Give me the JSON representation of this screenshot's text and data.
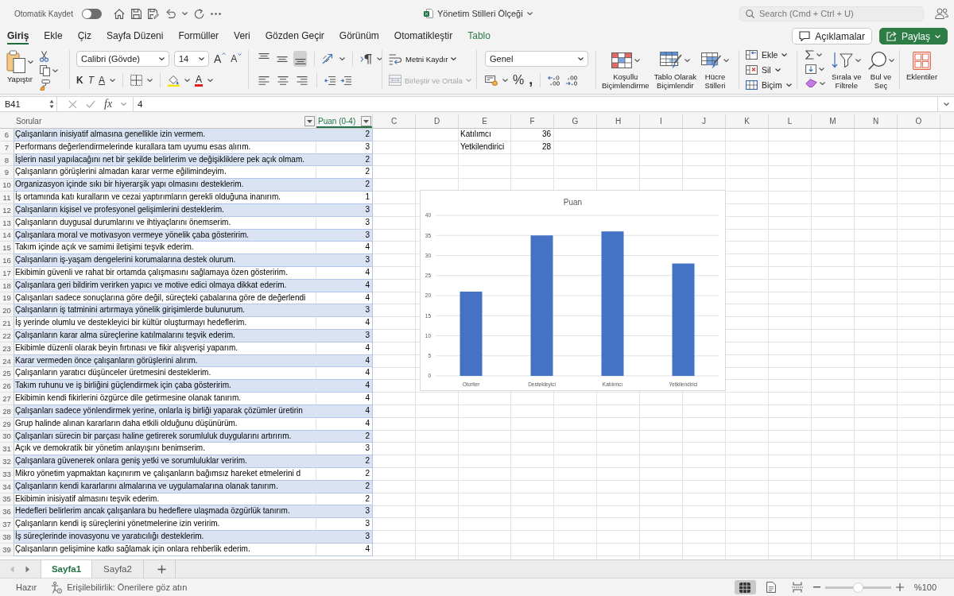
{
  "title_bar": {
    "autosave": {
      "label": "Otomatik Kaydet",
      "on": false
    },
    "document_title": "Yönetim Stilleri Ölçeği",
    "search": {
      "placeholder": "Search (Cmd + Ctrl + U)"
    }
  },
  "ribbon_tabs": [
    {
      "label": "Giriş",
      "selected": true,
      "kind": "standard"
    },
    {
      "label": "Ekle",
      "selected": false,
      "kind": "standard"
    },
    {
      "label": "Çiz",
      "selected": false,
      "kind": "standard"
    },
    {
      "label": "Sayfa Düzeni",
      "selected": false,
      "kind": "standard"
    },
    {
      "label": "Formüller",
      "selected": false,
      "kind": "standard"
    },
    {
      "label": "Veri",
      "selected": false,
      "kind": "standard"
    },
    {
      "label": "Gözden Geçir",
      "selected": false,
      "kind": "standard"
    },
    {
      "label": "Görünüm",
      "selected": false,
      "kind": "standard"
    },
    {
      "label": "Otomatikleştir",
      "selected": false,
      "kind": "standard"
    },
    {
      "label": "Tablo",
      "selected": false,
      "kind": "contextual"
    }
  ],
  "header_buttons": [
    {
      "label": "Açıklamalar",
      "kind": "comments"
    },
    {
      "label": "Paylaş",
      "kind": "share"
    }
  ],
  "ribbon": {
    "clipboard": {
      "paste": "Yapıştır"
    },
    "font": {
      "name": "Calibri (Gövde)",
      "size": "14",
      "grow": "A",
      "shrink": "A",
      "bold": "K",
      "italic": "T",
      "underline": "A",
      "font_color": "A"
    },
    "alignment": {
      "vertical": [
        {
          "kind": "top",
          "selected": false
        },
        {
          "kind": "middle",
          "selected": false
        },
        {
          "kind": "bottom",
          "selected": true
        }
      ],
      "horizontal": [
        {
          "kind": "left",
          "selected": false
        },
        {
          "kind": "center",
          "selected": false
        },
        {
          "kind": "right",
          "selected": false
        }
      ],
      "wrap_text": "Metni Kaydır",
      "merge": {
        "label": "Birleştir ve Ortala",
        "disabled": true
      }
    },
    "number": {
      "format": "Genel",
      "percent": "%",
      "comma": ","
    },
    "styles": [
      {
        "kind": "conditional",
        "lines": [
          "Koşullu",
          "Biçimlendirme"
        ]
      },
      {
        "kind": "table",
        "lines": [
          "Tablo Olarak",
          "Biçimlendir"
        ]
      },
      {
        "kind": "cell",
        "lines": [
          "Hücre",
          "Stilleri"
        ]
      }
    ],
    "cells": [
      {
        "kind": "insert",
        "label": "Ekle"
      },
      {
        "kind": "delete",
        "label": "Sil"
      },
      {
        "kind": "format",
        "label": "Biçim"
      }
    ],
    "editing": [
      {
        "kind": "sort_filter",
        "lines": [
          "Sırala ve",
          "Filtrele"
        ]
      },
      {
        "kind": "find",
        "lines": [
          "Bul ve",
          "Seç"
        ]
      }
    ],
    "add_ins": "Eklentiler"
  },
  "formula_bar": {
    "name_box": "B41",
    "function_label": "fx",
    "formula": "4"
  },
  "sheet": {
    "columns": [
      {
        "label": "Sorular",
        "kind": "table_header",
        "selected": false
      },
      {
        "label": "Puan (0-4)",
        "kind": "table_header",
        "selected": true
      },
      {
        "label": "C",
        "kind": "letter",
        "selected": false
      },
      {
        "label": "D",
        "kind": "letter",
        "selected": false
      },
      {
        "label": "E",
        "kind": "letter",
        "selected": false
      },
      {
        "label": "F",
        "kind": "letter",
        "selected": false
      },
      {
        "label": "G",
        "kind": "letter",
        "selected": false
      },
      {
        "label": "H",
        "kind": "letter",
        "selected": false
      },
      {
        "label": "I",
        "kind": "letter",
        "selected": false
      },
      {
        "label": "J",
        "kind": "letter",
        "selected": false
      },
      {
        "label": "K",
        "kind": "letter",
        "selected": false
      },
      {
        "label": "L",
        "kind": "letter",
        "selected": false
      },
      {
        "label": "M",
        "kind": "letter",
        "selected": false
      },
      {
        "label": "N",
        "kind": "letter",
        "selected": false
      },
      {
        "label": "O",
        "kind": "letter",
        "selected": false
      }
    ],
    "rows": [
      {
        "number": "6",
        "sorular": "Çalışanların inisiyatif almasına genellikle izin vermem.",
        "puan": "2",
        "column_e": "Katılımcı",
        "column_f": "36"
      },
      {
        "number": "7",
        "sorular": "Performans değerlendirmelerinde kurallara tam uyumu esas alırım.",
        "puan": "3",
        "column_e": "Yetkilendirici",
        "column_f": "28"
      },
      {
        "number": "8",
        "sorular": "İşlerin nasıl yapılacağını net bir şekilde belirlerim ve değişikliklere pek açık olmam.",
        "puan": "2"
      },
      {
        "number": "9",
        "sorular": "Çalışanların görüşlerini almadan karar verme eğilimindeyim.",
        "puan": "2"
      },
      {
        "number": "10",
        "sorular": "Organizasyon içinde sıkı bir hiyerarşik yapı olmasını desteklerim.",
        "puan": "2"
      },
      {
        "number": "11",
        "sorular": "İş ortamında katı kuralların ve cezai yaptırımların gerekli olduğuna inanırım.",
        "puan": "1"
      },
      {
        "number": "12",
        "sorular": "Çalışanların kişisel ve profesyonel gelişimlerini desteklerim.",
        "puan": "3"
      },
      {
        "number": "13",
        "sorular": "Çalışanların duygusal durumlarını ve ihtiyaçlarını önemserim.",
        "puan": "3"
      },
      {
        "number": "14",
        "sorular": "Çalışanlara moral ve motivasyon vermeye yönelik çaba gösteririm.",
        "puan": "3"
      },
      {
        "number": "15",
        "sorular": "Takım içinde açık ve samimi iletişimi teşvik ederim.",
        "puan": "4"
      },
      {
        "number": "16",
        "sorular": "Çalışanların iş-yaşam dengelerini korumalarına destek olurum.",
        "puan": "3"
      },
      {
        "number": "17",
        "sorular": "Ekibimin güvenli ve rahat bir ortamda çalışmasını sağlamaya özen gösteririm.",
        "puan": "4"
      },
      {
        "number": "18",
        "sorular": "Çalışanlara geri bildirim verirken yapıcı ve motive edici olmaya dikkat ederim.",
        "puan": "4"
      },
      {
        "number": "19",
        "sorular": "Çalışanları sadece sonuçlarına göre değil, süreçteki çabalarına göre de değerlendi",
        "puan": "4"
      },
      {
        "number": "20",
        "sorular": "Çalışanların iş tatminini artırmaya yönelik girişimlerde bulunurum.",
        "puan": "3"
      },
      {
        "number": "21",
        "sorular": "İş yerinde olumlu ve destekleyici bir kültür oluşturmayı hedeflerim.",
        "puan": "4"
      },
      {
        "number": "22",
        "sorular": "Çalışanların karar alma süreçlerine katılmalarını teşvik ederim.",
        "puan": "3"
      },
      {
        "number": "23",
        "sorular": "Ekibimle düzenli olarak beyin fırtınası ve fikir alışverişi yaparım.",
        "puan": "4"
      },
      {
        "number": "24",
        "sorular": "Karar vermeden önce çalışanların görüşlerini alırım.",
        "puan": "4"
      },
      {
        "number": "25",
        "sorular": "Çalışanların yaratıcı düşünceler üretmesini desteklerim.",
        "puan": "4"
      },
      {
        "number": "26",
        "sorular": "Takım ruhunu ve iş birliğini güçlendirmek için çaba gösteririm.",
        "puan": "4"
      },
      {
        "number": "27",
        "sorular": "Ekibimin kendi fikirlerini özgürce dile getirmesine olanak tanırım.",
        "puan": "4"
      },
      {
        "number": "28",
        "sorular": "Çalışanları sadece yönlendirmek yerine, onlarla iş birliği yaparak çözümler üretirin",
        "puan": "4"
      },
      {
        "number": "29",
        "sorular": "Grup halinde alınan kararların daha etkili olduğunu düşünürüm.",
        "puan": "4"
      },
      {
        "number": "30",
        "sorular": "Çalışanları sürecin bir parçası haline getirerek sorumluluk duygularını artırırım.",
        "puan": "2"
      },
      {
        "number": "31",
        "sorular": "Açık ve demokratik bir yönetim anlayışını benimserim.",
        "puan": "3"
      },
      {
        "number": "32",
        "sorular": "Çalışanlara güvenerek onlara geniş yetki ve sorumluluklar veririm.",
        "puan": "2"
      },
      {
        "number": "33",
        "sorular": "Mikro yönetim yapmaktan kaçınırım ve çalışanların bağımsız hareket etmelerini d",
        "puan": "2"
      },
      {
        "number": "34",
        "sorular": "Çalışanların kendi kararlarını almalarına ve uygulamalarına olanak tanırım.",
        "puan": "2"
      },
      {
        "number": "35",
        "sorular": "Ekibimin inisiyatif almasını teşvik ederim.",
        "puan": "2"
      },
      {
        "number": "36",
        "sorular": "Hedefleri belirlerim ancak çalışanlara bu hedeflere ulaşmada özgürlük tanırım.",
        "puan": "3"
      },
      {
        "number": "37",
        "sorular": "Çalışanların kendi iş süreçlerini yönetmelerine izin veririm.",
        "puan": "3"
      },
      {
        "number": "38",
        "sorular": "İş süreçlerinde inovasyonu ve yaratıcılığı desteklerim.",
        "puan": "3"
      },
      {
        "number": "39",
        "sorular": "Çalışanların gelişimine katkı sağlamak için onlara rehberlik ederim.",
        "puan": "4"
      }
    ],
    "chart": {
      "chart_data": {
        "type": "bar",
        "title": "Puan",
        "categories": [
          "Otoriter",
          "Destekleyici",
          "Katılımcı",
          "Yetkilendirici"
        ],
        "values": [
          21,
          35,
          36,
          28
        ],
        "ylim": [
          0,
          40
        ],
        "yticks": [
          0,
          5,
          10,
          15,
          20,
          25,
          30,
          35,
          40
        ],
        "grid": true
      }
    }
  },
  "sheet_tabs": [
    {
      "label": "Sayfa1",
      "selected": true
    },
    {
      "label": "Sayfa2",
      "selected": false
    }
  ],
  "status_bar": {
    "status": "Hazır",
    "accessibility": "Erişilebilirlik: Önerilere göz atın",
    "views": [
      {
        "kind": "normal",
        "selected": true
      },
      {
        "kind": "page_layout",
        "selected": false
      },
      {
        "kind": "page_break",
        "selected": false
      }
    ],
    "zoom": {
      "level": 0.5,
      "label": "%100"
    }
  }
}
